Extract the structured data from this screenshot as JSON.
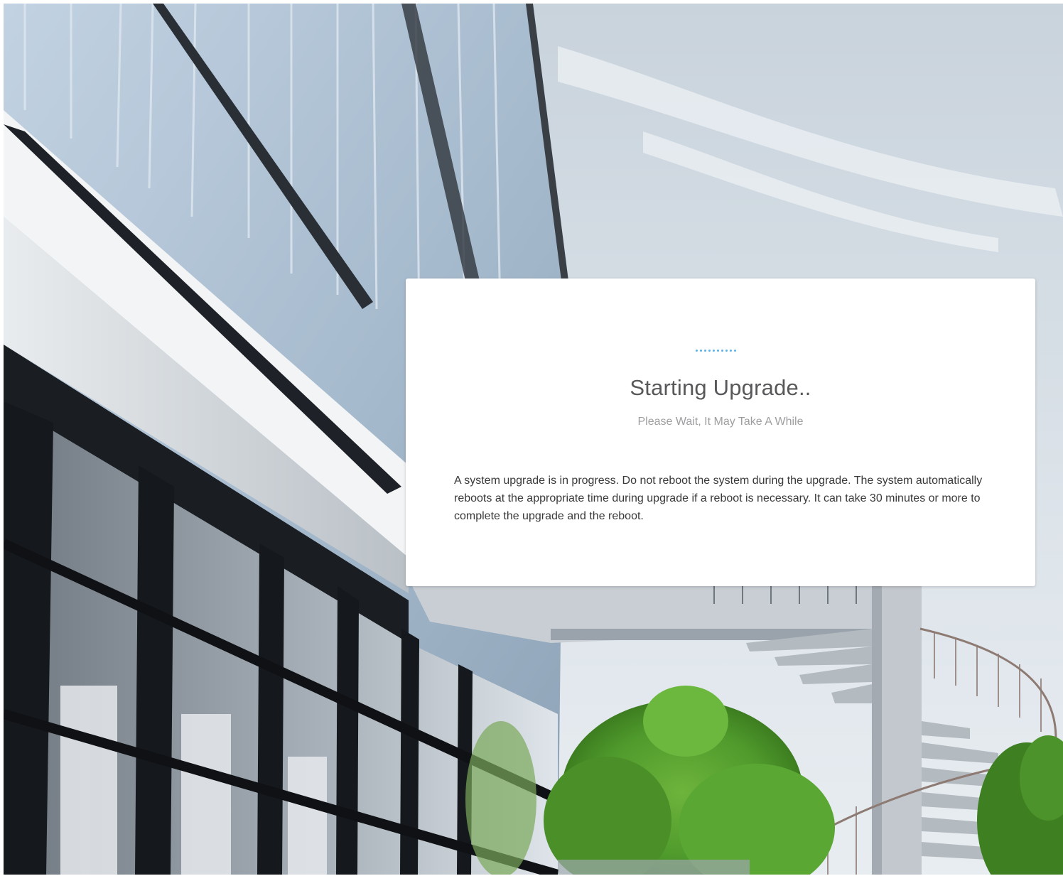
{
  "upgrade_dialog": {
    "title": "Starting Upgrade..",
    "subtitle": "Please Wait, It May Take A While",
    "message": "A system upgrade is in progress. Do not reboot the system during the upgrade. The system automatically reboots at the appropriate time during upgrade if a reboot is necessary. It can take 30 minutes or more to complete the upgrade and the reboot.",
    "loader_icon": "dotted-progress-icon",
    "accent_color": "#5bb4e8"
  },
  "background": {
    "description_icon": "building-photo-background"
  }
}
